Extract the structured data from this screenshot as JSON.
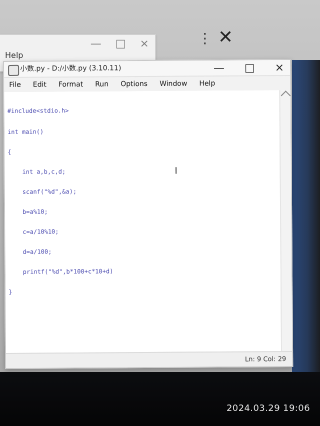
{
  "background_window": {
    "menu_label": "Help"
  },
  "window": {
    "title": "小数.py - D:/小数.py (3.10.11)",
    "menu": [
      "File",
      "Edit",
      "Format",
      "Run",
      "Options",
      "Window",
      "Help"
    ],
    "code_lines": [
      "#include<stdio.h>",
      "int main()",
      "{",
      "    int a,b,c,d;",
      "    scanf(\"%d\",&a);",
      "    b=a%10;",
      "    c=a/10%10;",
      "    d=a/100;",
      "    printf(\"%d\",b*100+c*10+d)",
      "}"
    ],
    "status": {
      "position": "Ln: 9   Col: 29"
    }
  },
  "photo": {
    "timestamp": "2024.03.29  19:06"
  },
  "colors": {
    "code_text": "#4b4bb0",
    "window_bg": "#f6f6f6",
    "editor_bg": "#ffffff"
  }
}
